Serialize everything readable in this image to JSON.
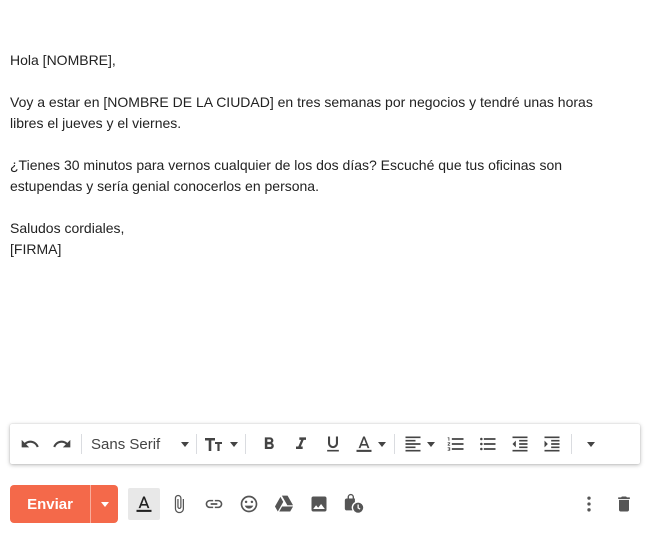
{
  "message": {
    "greeting": "Hola [NOMBRE],",
    "paragraph1_line1": "Voy a estar en [NOMBRE DE LA CIUDAD] en tres semanas por negocios y tendré unas horas",
    "paragraph1_line2": "libres el jueves y el viernes.",
    "paragraph2_line1": "¿Tienes 30 minutos para vernos cualquier de los dos días? Escuché que tus oficinas son",
    "paragraph2_line2": "estupendas y sería genial conocerlos en persona.",
    "closing": "Saludos cordiales,",
    "signature": "[FIRMA]"
  },
  "format_toolbar": {
    "font_family": "Sans Serif",
    "icons": [
      "undo-icon",
      "redo-icon",
      "font-size-icon",
      "bold-icon",
      "italic-icon",
      "underline-icon",
      "text-color-icon",
      "align-icon",
      "numbered-list-icon",
      "bulleted-list-icon",
      "indent-less-icon",
      "indent-more-icon",
      "more-formatting-icon"
    ]
  },
  "compose_actions": {
    "send_label": "Enviar",
    "send_color": "#f4694a",
    "icons": [
      "formatting-options-icon",
      "attach-icon",
      "link-icon",
      "emoji-icon",
      "drive-icon",
      "photo-icon",
      "confidential-mode-icon",
      "more-options-icon",
      "discard-icon"
    ]
  }
}
